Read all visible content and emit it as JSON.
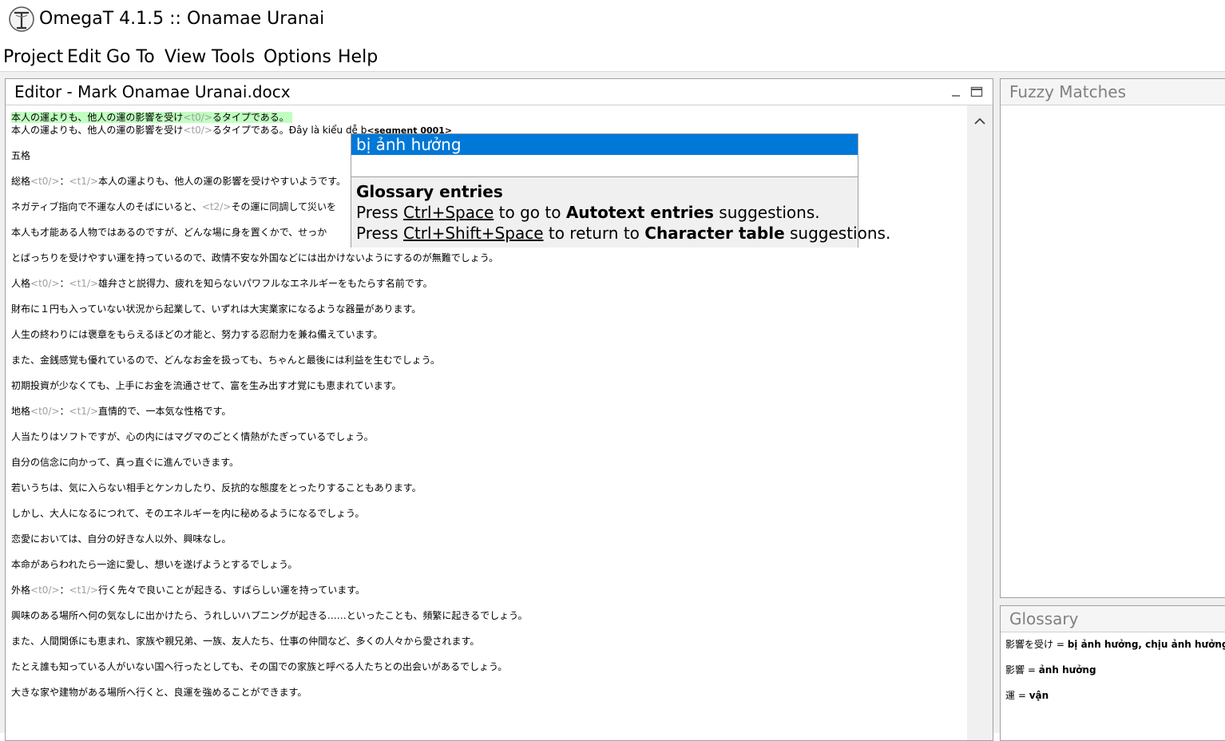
{
  "app": {
    "title": "OmegaT 4.1.5 :: Onamae Uranai"
  },
  "menu": [
    "Project",
    "Edit",
    "Go To",
    "View",
    "Tools",
    "Options",
    "Help"
  ],
  "editor": {
    "title": "Editor - Mark Onamae Uranai.docx",
    "active_segment": {
      "source_a": "本人の運よりも、他人の運の影響を受け",
      "tag": "<t0/>",
      "source_b": "るタイプである。",
      "target_a": "本人の運よりも、他人の運の影響を受け",
      "target_tag": "<t0/>",
      "target_b": "るタイプである。Đây là kiểu dễ b",
      "marker": "<segment 0001>"
    },
    "segments": [
      [
        {
          "t": "五格"
        }
      ],
      [
        {
          "t": "総格"
        },
        {
          "t": "<t0/>",
          "tag": true
        },
        {
          "t": "："
        },
        {
          "t": "<t1/>",
          "tag": true
        },
        {
          "t": "本人の運よりも、他人の運の影響を受けやすいようです。"
        }
      ],
      [
        {
          "t": "ネガティブ指向で不運な人のそばにいると、"
        },
        {
          "t": "<t2/>",
          "tag": true
        },
        {
          "t": "その運に同調して災いを"
        }
      ],
      [
        {
          "t": "本人も才能ある人物ではあるのですが、どんな場に身を置くかで、せっか"
        }
      ],
      [
        {
          "t": "とばっちりを受けやすい運を持っているので、政情不安な外国などには出かけないようにするのが無難でしょう。"
        }
      ],
      [
        {
          "t": "人格"
        },
        {
          "t": "<t0/>",
          "tag": true
        },
        {
          "t": "："
        },
        {
          "t": "<t1/>",
          "tag": true
        },
        {
          "t": "雄弁さと説得力、疲れを知らないパワフルなエネルギーをもたらす名前です。"
        }
      ],
      [
        {
          "t": "財布に１円も入っていない状況から起業して、いずれは大実業家になるような器量があります。"
        }
      ],
      [
        {
          "t": "人生の終わりには褒章をもらえるほどの才能と、努力する忍耐力を兼ね備えています。"
        }
      ],
      [
        {
          "t": "また、金銭感覚も優れているので、どんなお金を扱っても、ちゃんと最後には利益を生むでしょう。"
        }
      ],
      [
        {
          "t": "初期投資が少なくても、上手にお金を流通させて、富を生み出す才覚にも恵まれています。"
        }
      ],
      [
        {
          "t": "地格"
        },
        {
          "t": "<t0/>",
          "tag": true
        },
        {
          "t": "："
        },
        {
          "t": "<t1/>",
          "tag": true
        },
        {
          "t": "直情的で、一本気な性格です。"
        }
      ],
      [
        {
          "t": "人当たりはソフトですが、心の内にはマグマのごとく情熱がたぎっているでしょう。"
        }
      ],
      [
        {
          "t": "自分の信念に向かって、真っ直ぐに進んでいきます。"
        }
      ],
      [
        {
          "t": "若いうちは、気に入らない相手とケンカしたり、反抗的な態度をとったりすることもあります。"
        }
      ],
      [
        {
          "t": "しかし、大人になるにつれて、そのエネルギーを内に秘めるようになるでしょう。"
        }
      ],
      [
        {
          "t": "恋愛においては、自分の好きな人以外、興味なし。"
        }
      ],
      [
        {
          "t": "本命があらわれたら一途に愛し、想いを遂げようとするでしょう。"
        }
      ],
      [
        {
          "t": "外格"
        },
        {
          "t": "<t0/>",
          "tag": true
        },
        {
          "t": "："
        },
        {
          "t": "<t1/>",
          "tag": true
        },
        {
          "t": "行く先々で良いことが起きる、すばらしい運を持っています。"
        }
      ],
      [
        {
          "t": "興味のある場所へ何の気なしに出かけたら、うれしいハプニングが起きる……といったことも、頻繁に起きるでしょう。"
        }
      ],
      [
        {
          "t": "また、人間関係にも恵まれ、家族や親兄弟、一族、友人たち、仕事の仲間など、多くの人々から愛されます。"
        }
      ],
      [
        {
          "t": "たとえ誰も知っている人がいない国へ行ったとしても、その国での家族と呼べる人たちとの出会いがあるでしょう。"
        }
      ],
      [
        {
          "t": "大きな家や建物がある場所へ行くと、良運を強めることができます。"
        }
      ]
    ]
  },
  "popup": {
    "selected": "bị ảnh hưởng",
    "heading": "Glossary entries",
    "line1": {
      "a": "Press ",
      "key": "Ctrl+Space",
      "b": " to go to ",
      "bold": "Autotext entries",
      "c": " suggestions."
    },
    "line2": {
      "a": "Press ",
      "key": "Ctrl+Shift+Space",
      "b": " to return to ",
      "bold": "Character table",
      "c": " suggestions."
    }
  },
  "fuzzy": {
    "title": "Fuzzy Matches"
  },
  "glossary": {
    "title": "Glossary",
    "entries": [
      {
        "term": "影響を受け",
        "sep": " = ",
        "translation": "bị ảnh hưởng, chịu ảnh hưởng"
      },
      {
        "term": "影響",
        "sep": " = ",
        "translation": "ảnh hưởng"
      },
      {
        "term": "運",
        "sep": " = ",
        "translation": "vận"
      }
    ]
  }
}
